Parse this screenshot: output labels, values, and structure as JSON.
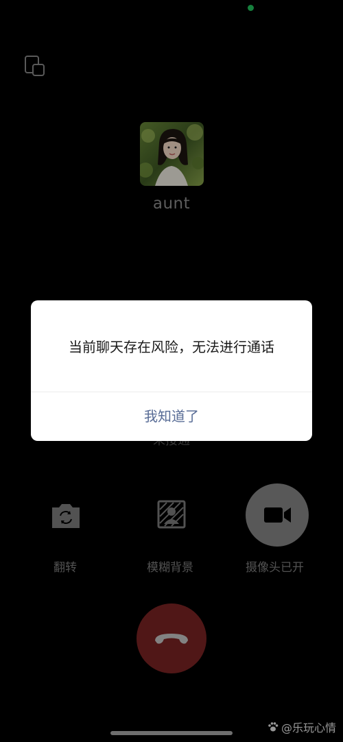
{
  "call": {
    "contact_name": "aunt",
    "status": "未接通"
  },
  "controls": {
    "flip_label": "翻转",
    "blur_label": "模糊背景",
    "camera_label": "摄像头已开"
  },
  "dialog": {
    "message": "当前聊天存在风险，无法进行通话",
    "confirm_label": "我知道了"
  },
  "watermark": {
    "text": "@乐玩心情"
  },
  "colors": {
    "background": "#000000",
    "hangup": "#7c2424",
    "dialog_button": "#576b95",
    "status_dot": "#22c55e"
  }
}
